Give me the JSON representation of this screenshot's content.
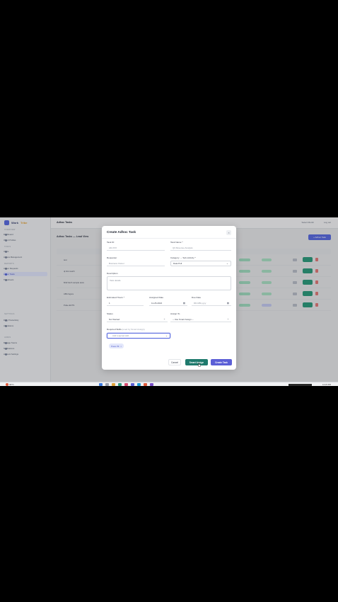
{
  "background": {
    "logo": {
      "text": "Work",
      "accent": "Tribe"
    },
    "page_title": "Adhoc Tasks",
    "top_right": [
      "Select Month",
      "Log out"
    ],
    "content_heading": "Adhoc Tasks — Lead View",
    "new_button": "+ Adhoc Task",
    "sidebar_sections": [
      "Overview",
      "Tasks",
      "Reports",
      "Settings",
      "Admin"
    ],
    "sidebar_items": [
      "Dashboard",
      "Org & Profiles",
      "Users",
      "Access Management",
      "Adhoc Requests",
      "Adhoc Tasks",
      "Timesheets",
      "Daily Productivity",
      "Attendance",
      "Manage Teams",
      "Notifications",
      "Account Settings"
    ],
    "table_rows": [
      "test",
      "ql link match",
      "M42 fetch sample tests",
      "ABA fugure",
      "Pulse ECTS"
    ],
    "colors": {
      "brand": "#5b6ce0",
      "accent": "#e2a33a",
      "success": "#2f9c7e"
    }
  },
  "modal": {
    "title": "Create Adhoc Task",
    "close_icon": "×",
    "task_id": {
      "label": "Task ID",
      "value": "AD-XXX"
    },
    "task_name": {
      "label": "Task Name *",
      "placeholder": "Q3 Revenue Analysis"
    },
    "requester": {
      "label": "Requester",
      "placeholder": "Business Owner"
    },
    "category": {
      "label": "Category → Sub-Activity *",
      "value": "Data Pull"
    },
    "description": {
      "label": "Description",
      "placeholder": "Task details"
    },
    "estimated_hours": {
      "label": "Estimated Hours *",
      "value": "1"
    },
    "assigned_date": {
      "label": "Assigned Date",
      "value": "11-26-2024"
    },
    "due_date": {
      "label": "Due Date",
      "placeholder": "DD-MM-yyyy"
    },
    "status": {
      "label": "Status",
      "value": "Not Started"
    },
    "assign_to": {
      "label": "Assign To",
      "value": "-- Use Smart Assign --"
    },
    "required_skills": {
      "label": "Required Skills",
      "hint": "(used by Smart Assign)",
      "placeholder": "Add required skill"
    },
    "selected_skill": {
      "label": "Power BI",
      "remove": "×"
    },
    "buttons": {
      "cancel": "Cancel",
      "smart_assign": "Smart Assign",
      "create": "Create Task"
    },
    "colors": {
      "primary": "#5b5fd6",
      "smart_assign": "#1f7a6d"
    }
  },
  "taskbar": {
    "weather": "30°C",
    "time": "12:23 PM"
  }
}
